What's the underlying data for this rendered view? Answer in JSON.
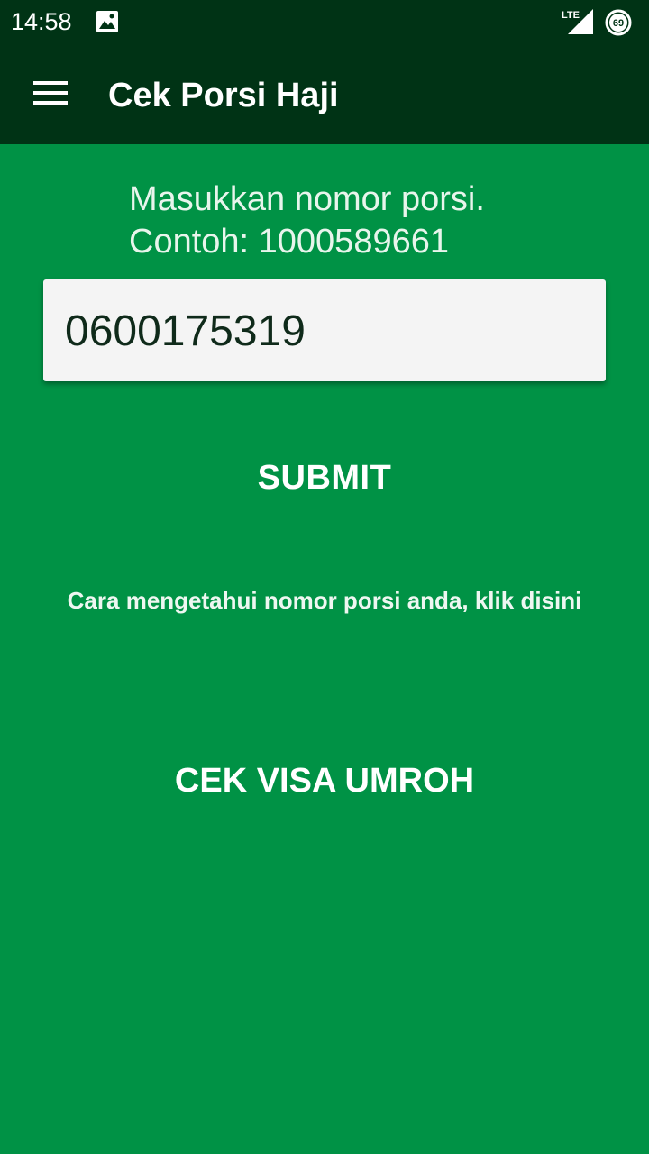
{
  "status_bar": {
    "time": "14:58",
    "network_label": "LTE",
    "battery_level": "69",
    "icons": [
      "image-notification-icon",
      "lte-signal-icon",
      "battery-icon"
    ]
  },
  "app_bar": {
    "title": "Cek Porsi Haji",
    "menu_icon": "hamburger-menu-icon"
  },
  "form": {
    "instruction_line1": "Masukkan nomor porsi.",
    "instruction_line2": "Contoh: 1000589661",
    "porsi_value": "0600175319",
    "submit_label": "SUBMIT",
    "help_link": "Cara mengetahui nomor porsi anda, klik disini",
    "visa_label": "CEK VISA UMROH"
  },
  "colors": {
    "background": "#009245",
    "app_bar": "#003315",
    "input_background": "#f4f4f4"
  }
}
